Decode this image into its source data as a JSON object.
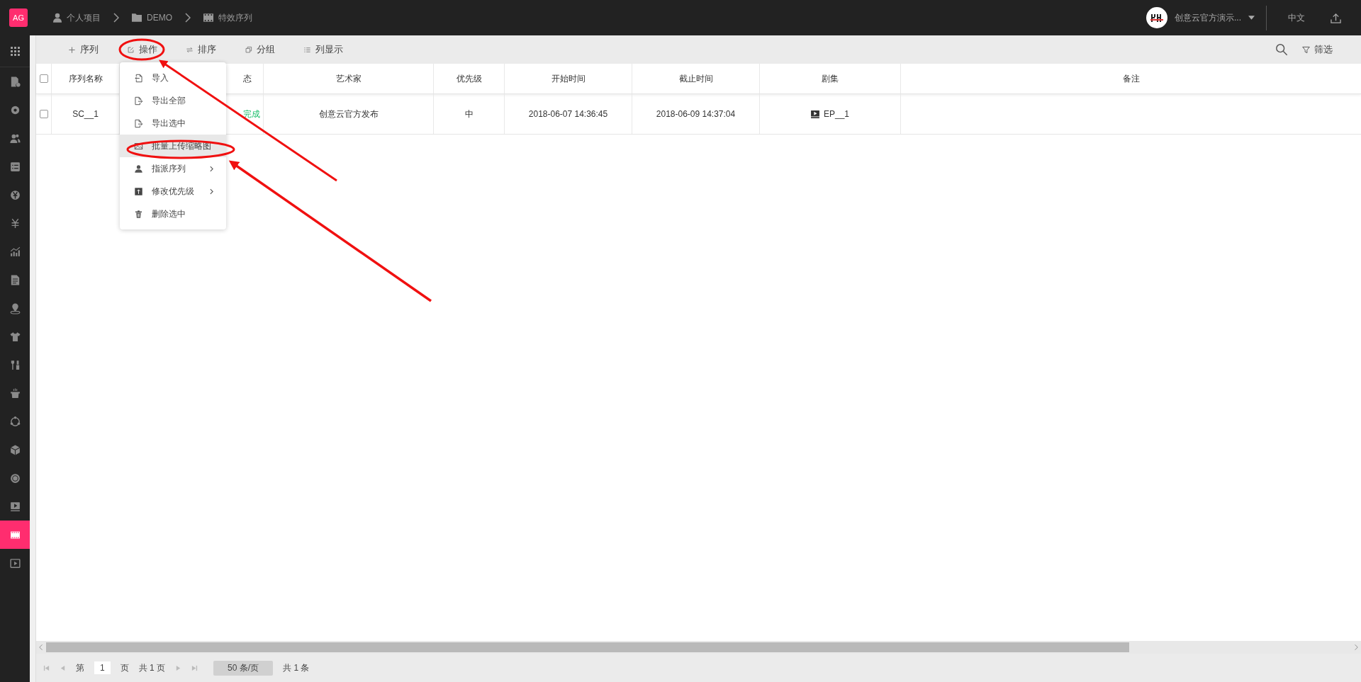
{
  "app_logo": "AG",
  "breadcrumb": [
    {
      "label": "个人项目"
    },
    {
      "label": "DEMO"
    },
    {
      "label": "特效序列"
    }
  ],
  "user": {
    "name": "创意云官方演示..."
  },
  "language": "中文",
  "sidebar": {
    "items": [
      {
        "selected": false
      },
      {
        "selected": false
      },
      {
        "selected": false
      },
      {
        "selected": false
      },
      {
        "selected": false
      },
      {
        "selected": false
      },
      {
        "selected": false
      },
      {
        "selected": false
      },
      {
        "selected": false
      },
      {
        "selected": false
      },
      {
        "selected": false
      },
      {
        "selected": false
      },
      {
        "selected": false
      },
      {
        "selected": false
      },
      {
        "selected": false
      },
      {
        "selected": false
      },
      {
        "selected": false
      },
      {
        "selected": true
      },
      {
        "selected": false
      }
    ]
  },
  "toolbar": {
    "buttons": [
      {
        "label": "序列"
      },
      {
        "label": "操作"
      },
      {
        "label": "排序"
      },
      {
        "label": "分组"
      },
      {
        "label": "列显示"
      }
    ],
    "filter": "筛选"
  },
  "table": {
    "all_checked": false,
    "columns": [
      "序列名称",
      "态",
      "艺术家",
      "优先级",
      "开始时间",
      "截止时间",
      "剧集",
      "备注"
    ],
    "rows": [
      {
        "checked": false,
        "name": "SC__1",
        "status": "完成",
        "artist": "创意云官方发布",
        "priority": "中",
        "start": "2018-06-07 14:36:45",
        "end": "2018-06-09 14:37:04",
        "episode": "EP__1"
      }
    ]
  },
  "menu": {
    "items": [
      {
        "label": "导入",
        "highlighted": false,
        "submenu": false
      },
      {
        "label": "导出全部",
        "highlighted": false,
        "submenu": false
      },
      {
        "label": "导出选中",
        "highlighted": false,
        "submenu": false
      },
      {
        "label": "批量上传缩略图",
        "highlighted": true,
        "submenu": false
      },
      {
        "label": "指派序列",
        "highlighted": false,
        "submenu": true
      },
      {
        "label": "修改优先级",
        "highlighted": false,
        "submenu": true
      },
      {
        "label": "删除选中",
        "highlighted": false,
        "submenu": false
      }
    ]
  },
  "pagination": {
    "page_prefix": "第",
    "page": "1",
    "page_suffix": "页",
    "total_pages": "共 1 页",
    "page_size": "50 条/页",
    "total": "共 1 条"
  }
}
